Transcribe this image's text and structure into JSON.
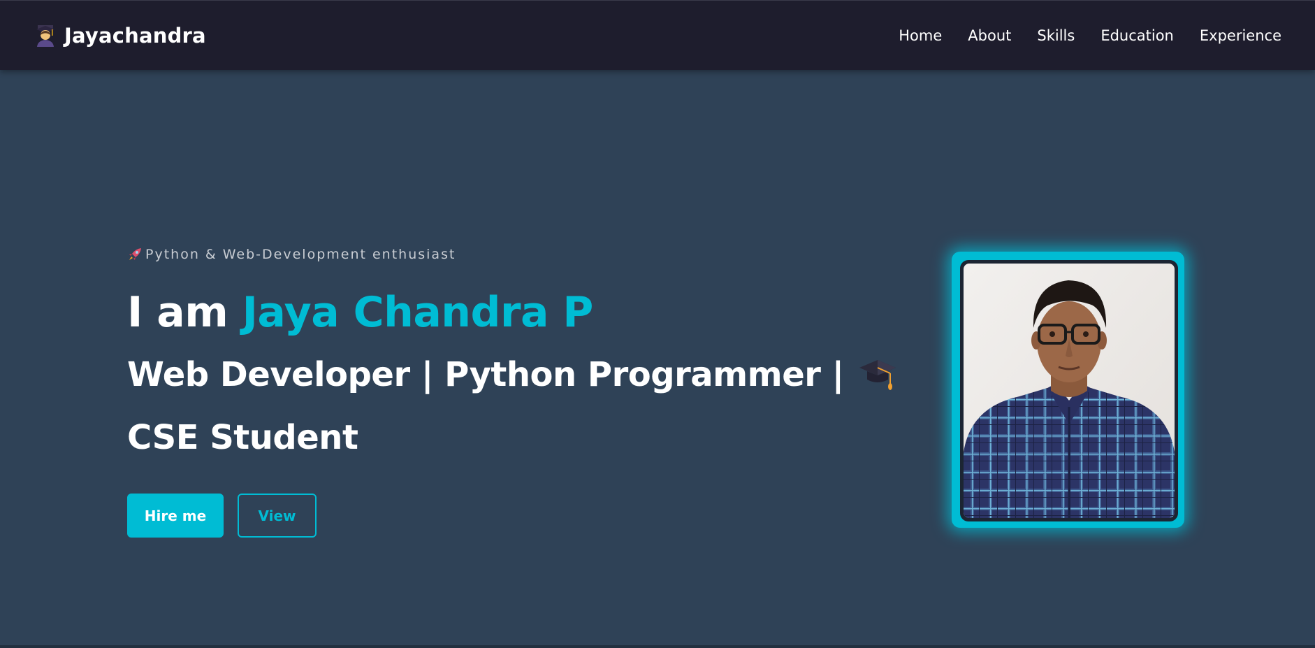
{
  "nav": {
    "brand": "Jayachandra",
    "brand_icon": "student-emoji-icon",
    "links": [
      "Home",
      "About",
      "Skills",
      "Education",
      "Experience"
    ]
  },
  "hero": {
    "tagline": "Python & Web-Development enthusiast",
    "tagline_icon": "rocket-icon",
    "greeting": "I am ",
    "name": "Jaya Chandra P",
    "roles_line": "Web Developer | Python Programmer | ",
    "roles_icon": "graduation-cap-icon",
    "roles_tail": " CSE Student",
    "hire_label": "Hire me",
    "view_label": "View",
    "photo_alt": "Jaya Chandra P"
  },
  "colors": {
    "accent": "#00bcd4",
    "navbar": "#1e1d2d",
    "background": "#2f4257",
    "text": "#ffffff",
    "muted": "#c9cdd3"
  }
}
